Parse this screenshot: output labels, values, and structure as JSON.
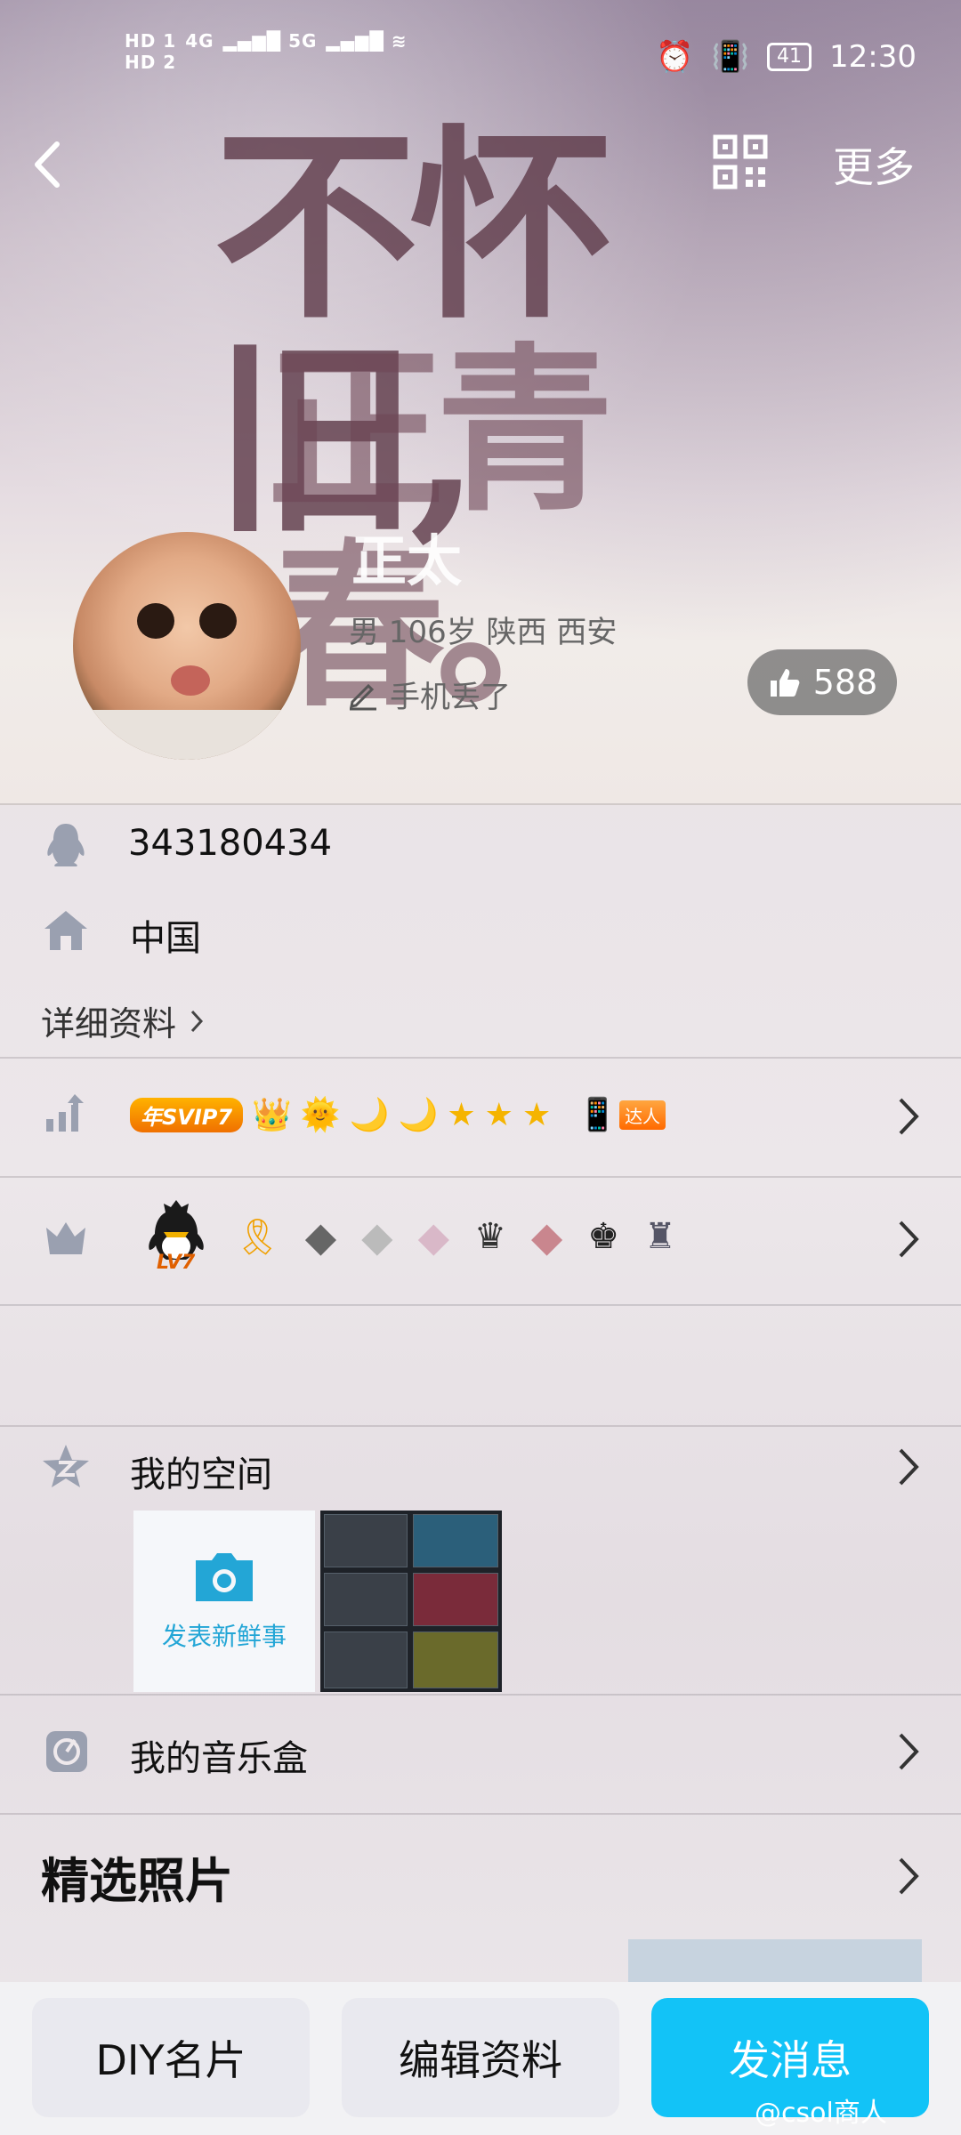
{
  "status_bar": {
    "sim1": "HD 1",
    "sim2": "HD 2",
    "net1": "4G",
    "net2": "5G",
    "battery": "41",
    "time": "12:30"
  },
  "nav": {
    "more_label": "更多"
  },
  "banner_text": {
    "line1": "不怀旧,",
    "line2": "正青春。"
  },
  "profile": {
    "nickname": "正太",
    "meta": "男 106岁 陕西 西安",
    "signature": "手机丢了",
    "likes": "588"
  },
  "info": {
    "qq_number": "343180434",
    "hometown": "中国",
    "detail_link": "详细资料"
  },
  "badges": {
    "svip": "年SVIP7",
    "daren": "达人",
    "qq_level": "LV7"
  },
  "space": {
    "title": "我的空间",
    "new_post": "发表新鲜事"
  },
  "music": {
    "title": "我的音乐盒"
  },
  "photos": {
    "title": "精选照片"
  },
  "bottom": {
    "diy": "DIY名片",
    "edit": "编辑资料",
    "message": "发消息"
  },
  "watermark": "@csol商人"
}
